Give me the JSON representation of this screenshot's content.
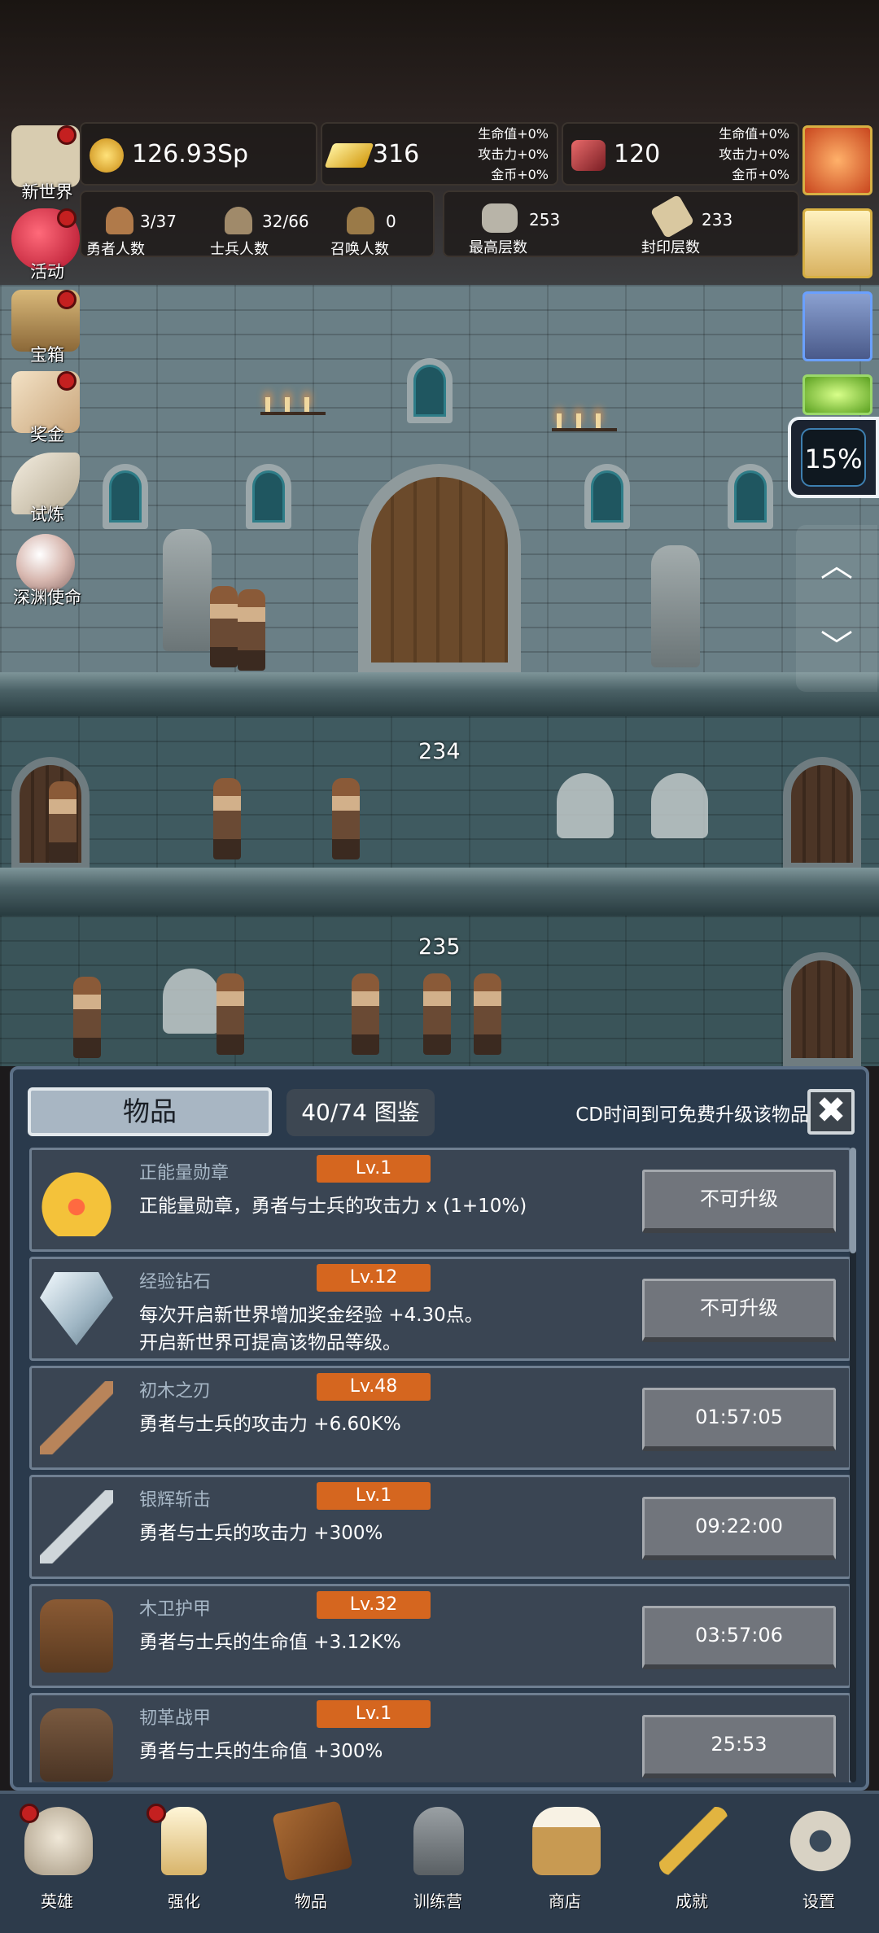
{
  "hud": {
    "gold": "126.93Sp",
    "gold_bar": "316",
    "gold_bar_bonus": [
      "生命值+0%",
      "攻击力+0%",
      "金币+0%"
    ],
    "gem": "120",
    "gem_bonus": [
      "生命值+0%",
      "攻击力+0%",
      "金币+0%"
    ],
    "heroes": {
      "value": "3/37",
      "label": "勇者人数"
    },
    "soldiers": {
      "value": "32/66",
      "label": "士兵人数"
    },
    "summons": {
      "value": "0",
      "label": "召唤人数"
    },
    "max_floor": {
      "value": "253",
      "label": "最高层数"
    },
    "seal_floor": {
      "value": "233",
      "label": "封印层数"
    }
  },
  "left_menu": [
    {
      "label": "新世界",
      "icon": "map-icon",
      "alert": true
    },
    {
      "label": "活动",
      "icon": "heart-icon",
      "alert": true
    },
    {
      "label": "宝箱",
      "icon": "chest-icon",
      "alert": true
    },
    {
      "label": "奖金",
      "icon": "envelope-icon",
      "alert": true
    },
    {
      "label": "试炼",
      "icon": "feather-icon",
      "alert": false
    },
    {
      "label": "深渊使命",
      "icon": "orb-icon",
      "alert": false
    }
  ],
  "right_menu": {
    "icons": [
      "potion-icon",
      "candle-icon",
      "backpack-icon",
      "slime-icon"
    ],
    "progress_percent": 15,
    "progress_text": "15%",
    "up_arrow": "︿",
    "down_arrow": "﹀"
  },
  "scene": {
    "floors": [
      "234",
      "235"
    ]
  },
  "items_panel": {
    "tab_title": "物品",
    "collection": "40/74 图鉴",
    "cd_hint": "CD时间到可免费升级该物品",
    "close_symbol": "✖",
    "items": [
      {
        "name": "正能量勋章",
        "level": "Lv.1",
        "desc": "正能量勋章，勇者与士兵的攻击力 x (1+10%)",
        "button": "不可升级",
        "icon": "crown-icon"
      },
      {
        "name": "经验钻石",
        "level": "Lv.12",
        "desc": "每次开启新世界增加奖金经验 +4.30点。\n开启新世界可提高该物品等级。",
        "button": "不可升级",
        "icon": "diamond-icon"
      },
      {
        "name": "初木之刃",
        "level": "Lv.48",
        "desc": "勇者与士兵的攻击力 +6.60K%",
        "button": "01:57:05",
        "icon": "wooden-sword-icon"
      },
      {
        "name": "银辉斩击",
        "level": "Lv.1",
        "desc": "勇者与士兵的攻击力 +300%",
        "button": "09:22:00",
        "icon": "silver-sword-icon"
      },
      {
        "name": "木卫护甲",
        "level": "Lv.32",
        "desc": "勇者与士兵的生命值 +3.12K%",
        "button": "03:57:06",
        "icon": "wooden-armor-icon"
      },
      {
        "name": "韧革战甲",
        "level": "Lv.1",
        "desc": "勇者与士兵的生命值 +300%",
        "button": "25:53",
        "icon": "leather-armor-icon"
      }
    ]
  },
  "bottom_nav": [
    {
      "label": "英雄",
      "icon": "skull-icon",
      "alert": true
    },
    {
      "label": "强化",
      "icon": "candle-icon",
      "alert": true
    },
    {
      "label": "物品",
      "icon": "book-icon",
      "alert": false
    },
    {
      "label": "训练营",
      "icon": "lantern-icon",
      "alert": false
    },
    {
      "label": "商店",
      "icon": "beer-mug-icon",
      "alert": false
    },
    {
      "label": "成就",
      "icon": "key-icon",
      "alert": false
    },
    {
      "label": "设置",
      "icon": "gear-icon",
      "alert": false
    }
  ],
  "colors": {
    "panel_bg": "#2a3a4c",
    "level_badge": "#d5661f",
    "row_button": "#71757c",
    "alert_dot": "#c42020"
  }
}
